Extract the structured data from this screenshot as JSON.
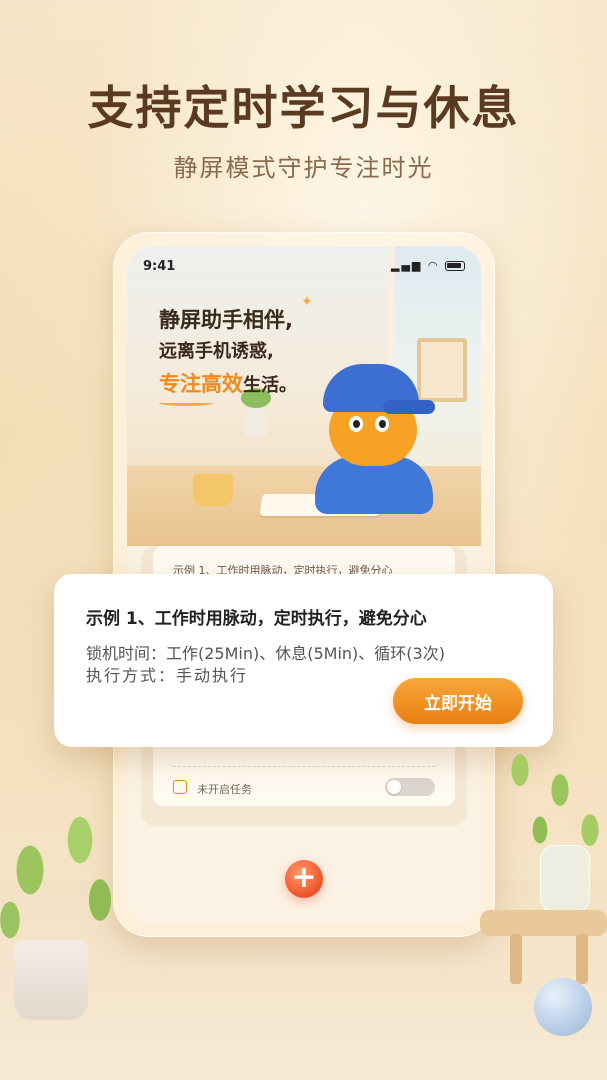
{
  "promo": {
    "headline": "支持定时学习与休息",
    "subheadline": "静屏模式守护专注时光"
  },
  "status_bar": {
    "time": "9:41",
    "icons": [
      "signal-icon",
      "wifi-icon",
      "battery-icon"
    ]
  },
  "hero": {
    "line1": "静屏助手相伴,",
    "line2": "远离手机诱惑,",
    "line3_accent": "专注高效",
    "line3_rest": "生活。"
  },
  "task_list": {
    "peek_text": "示例 1、工作时用脉动，定时执行，避免分心",
    "status_label": "未开启任务",
    "toggle_on": false
  },
  "overlay_card": {
    "title": "示例 1、工作时用脉动，定时执行，避免分心",
    "lock_time": "锁机时间：工作(25Min)、休息(5Min)、循环(3次)",
    "exec_mode": "执行方式：手动执行",
    "start_button": "立即开始"
  },
  "add_button": {
    "label": "+"
  },
  "colors": {
    "accent": "#f08a1c",
    "button_gradient_top": "#f7a73a",
    "button_gradient_bottom": "#e97f12",
    "add_button": "#f0512a",
    "headline": "#5a3b22"
  }
}
